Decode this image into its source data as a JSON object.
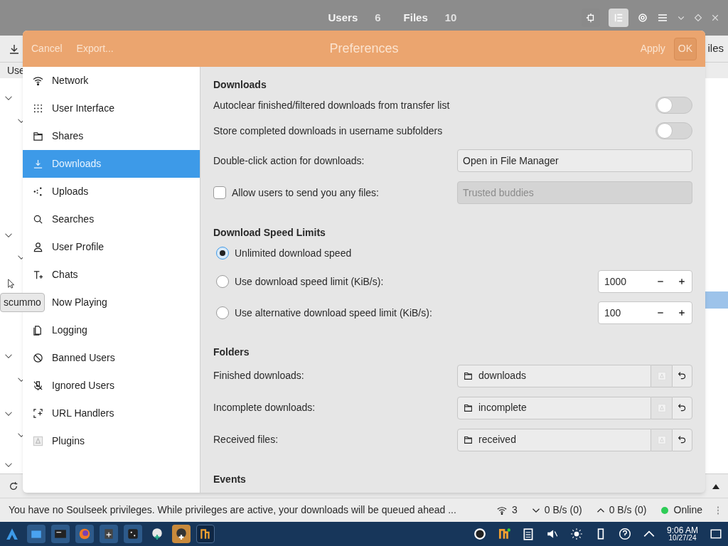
{
  "app": {
    "tabs": [
      {
        "label": "Users",
        "count": "6"
      },
      {
        "label": "Files",
        "count": "10"
      }
    ],
    "toolbar_fragment": "iles",
    "column_fragment": "Use",
    "tooltip": "scummo"
  },
  "preferences": {
    "title": "Preferences",
    "left_buttons": [
      "Cancel",
      "Export..."
    ],
    "right_buttons": [
      "Apply",
      "OK"
    ],
    "sidebar": [
      {
        "label": "Network",
        "selected": false
      },
      {
        "label": "User Interface",
        "selected": false
      },
      {
        "label": "Shares",
        "selected": false
      },
      {
        "label": "Downloads",
        "selected": true
      },
      {
        "label": "Uploads",
        "selected": false
      },
      {
        "label": "Searches",
        "selected": false
      },
      {
        "label": "User Profile",
        "selected": false
      },
      {
        "label": "Chats",
        "selected": false
      },
      {
        "label": "Now Playing",
        "selected": false
      },
      {
        "label": "Logging",
        "selected": false
      },
      {
        "label": "Banned Users",
        "selected": false
      },
      {
        "label": "Ignored Users",
        "selected": false
      },
      {
        "label": "URL Handlers",
        "selected": false
      },
      {
        "label": "Plugins",
        "selected": false
      }
    ],
    "sections": [
      {
        "heading": "Downloads",
        "rows": [
          {
            "kind": "switch",
            "label": "Autoclear finished/filtered downloads from transfer list",
            "on": false
          },
          {
            "kind": "switch",
            "label": "Store completed downloads in username subfolders",
            "on": false
          },
          {
            "kind": "dropdown",
            "label": "Double-click action for downloads:",
            "value": "Open in File Manager"
          },
          {
            "kind": "check_field",
            "label": "Allow users to send you any files:",
            "checked": false,
            "value": "Trusted buddies",
            "disabled": true
          }
        ]
      },
      {
        "heading": "Download Speed Limits",
        "rows": [
          {
            "kind": "radio",
            "label": "Unlimited download speed",
            "selected": true
          },
          {
            "kind": "radio",
            "label": "Use download speed limit (KiB/s):",
            "selected": false,
            "value": "1000"
          },
          {
            "kind": "radio",
            "label": "Use alternative download speed limit (KiB/s):",
            "selected": false,
            "value": "100"
          }
        ]
      },
      {
        "heading": "Folders",
        "rows": [
          {
            "kind": "folder",
            "label": "Finished downloads:",
            "value": "downloads"
          },
          {
            "kind": "folder",
            "label": "Incomplete downloads:",
            "value": "incomplete"
          },
          {
            "kind": "folder",
            "label": "Received files:",
            "value": "received"
          }
        ]
      },
      {
        "heading": "Events"
      }
    ]
  },
  "status_bar": {
    "message": "You have no Soulseek privileges. While privileges are active, your downloads will be queued ahead ...",
    "connections": "3",
    "download": "0 B/s (0)",
    "upload": "0 B/s (0)",
    "status": "Online"
  },
  "taskbar": {
    "time": "9:06 AM",
    "date": "10/27/24"
  }
}
